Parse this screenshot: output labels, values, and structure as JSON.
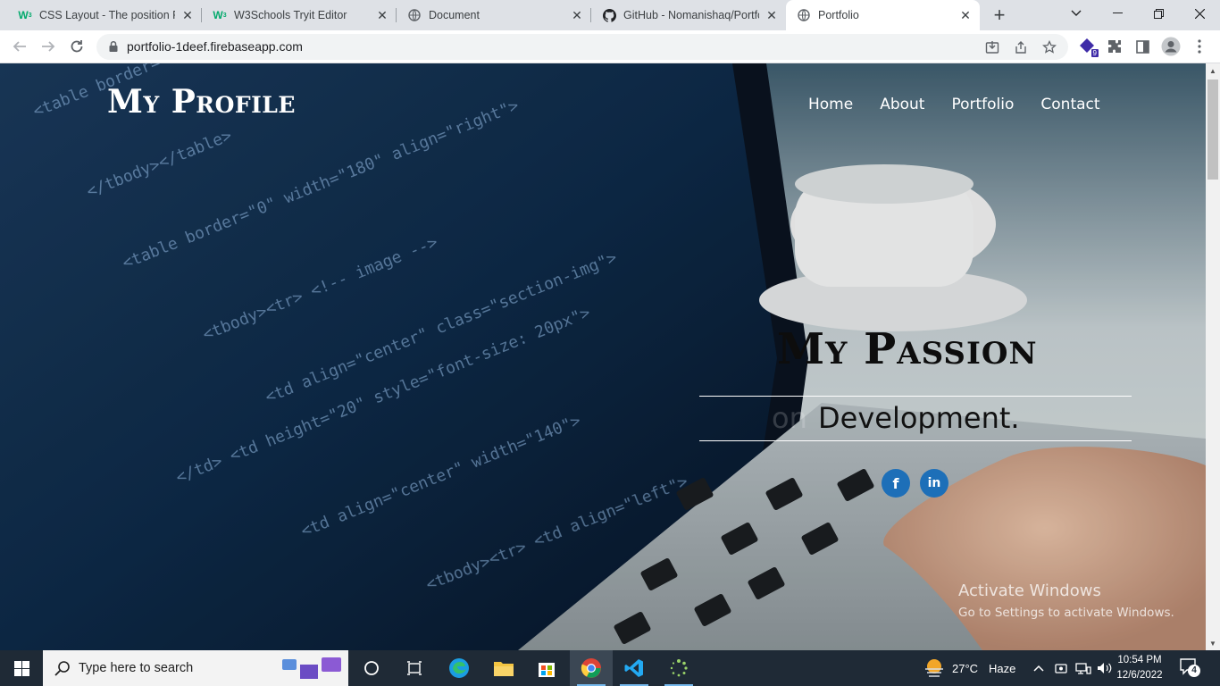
{
  "browser": {
    "tabs": [
      {
        "title": "CSS Layout - The position Pr",
        "favicon": "w3schools-icon",
        "favicon_color": "#04aa6d",
        "favicon_char": "W",
        "active": false
      },
      {
        "title": "W3Schools Tryit Editor",
        "favicon": "w3schools-icon",
        "favicon_color": "#04aa6d",
        "favicon_char": "W",
        "active": false
      },
      {
        "title": "Document",
        "favicon": "globe-icon",
        "active": false
      },
      {
        "title": "GitHub - Nomanishaq/Portfo",
        "favicon": "github-icon",
        "active": false
      },
      {
        "title": "Portfolio",
        "favicon": "globe-icon",
        "active": true
      }
    ],
    "url": "portfolio-1deef.firebaseapp.com",
    "extension_badge": "9"
  },
  "page": {
    "brand": "My Profile",
    "nav": [
      {
        "label": "Home"
      },
      {
        "label": "About"
      },
      {
        "label": "Portfolio"
      },
      {
        "label": "Contact"
      }
    ],
    "heading": "My Passion",
    "typed_text": "Development.",
    "typed_ghost": "on",
    "social": [
      {
        "name": "facebook",
        "glyph": "f"
      },
      {
        "name": "linkedin",
        "glyph": "in"
      }
    ],
    "social_color": "#1d6fb8"
  },
  "watermark": {
    "title": "Activate Windows",
    "subtitle": "Go to Settings to activate Windows."
  },
  "taskbar": {
    "search_placeholder": "Type here to search",
    "weather_temp": "27°C",
    "weather_text": "Haze",
    "time": "10:54 PM",
    "date": "12/6/2022",
    "notification_count": "4"
  }
}
